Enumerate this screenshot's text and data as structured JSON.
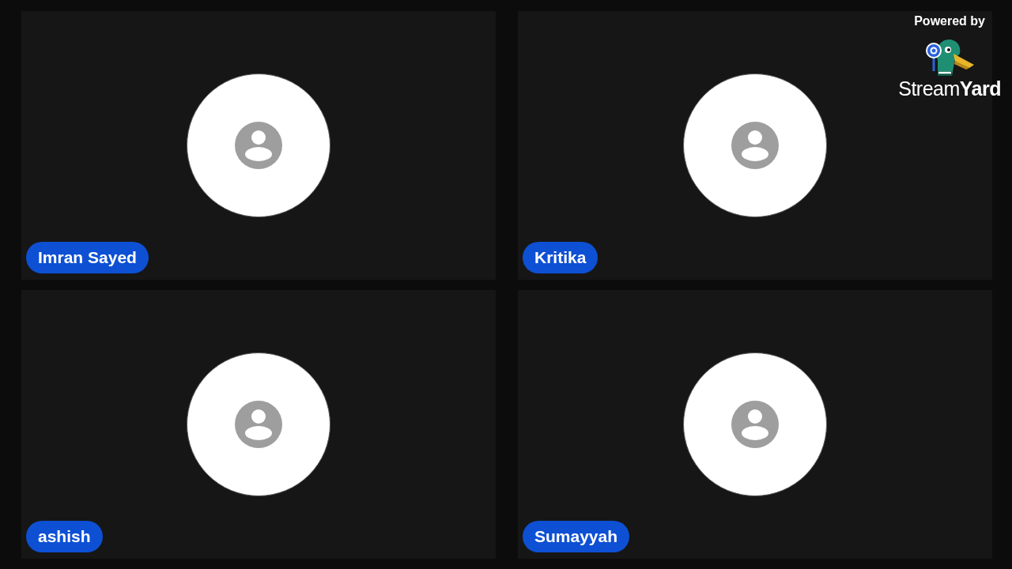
{
  "participants": [
    {
      "name": "Imran Sayed"
    },
    {
      "name": "Kritika"
    },
    {
      "name": "ashish"
    },
    {
      "name": "Sumayyah"
    }
  ],
  "branding": {
    "caption": "Powered by",
    "wordmark": "Stream**Yard**"
  }
}
